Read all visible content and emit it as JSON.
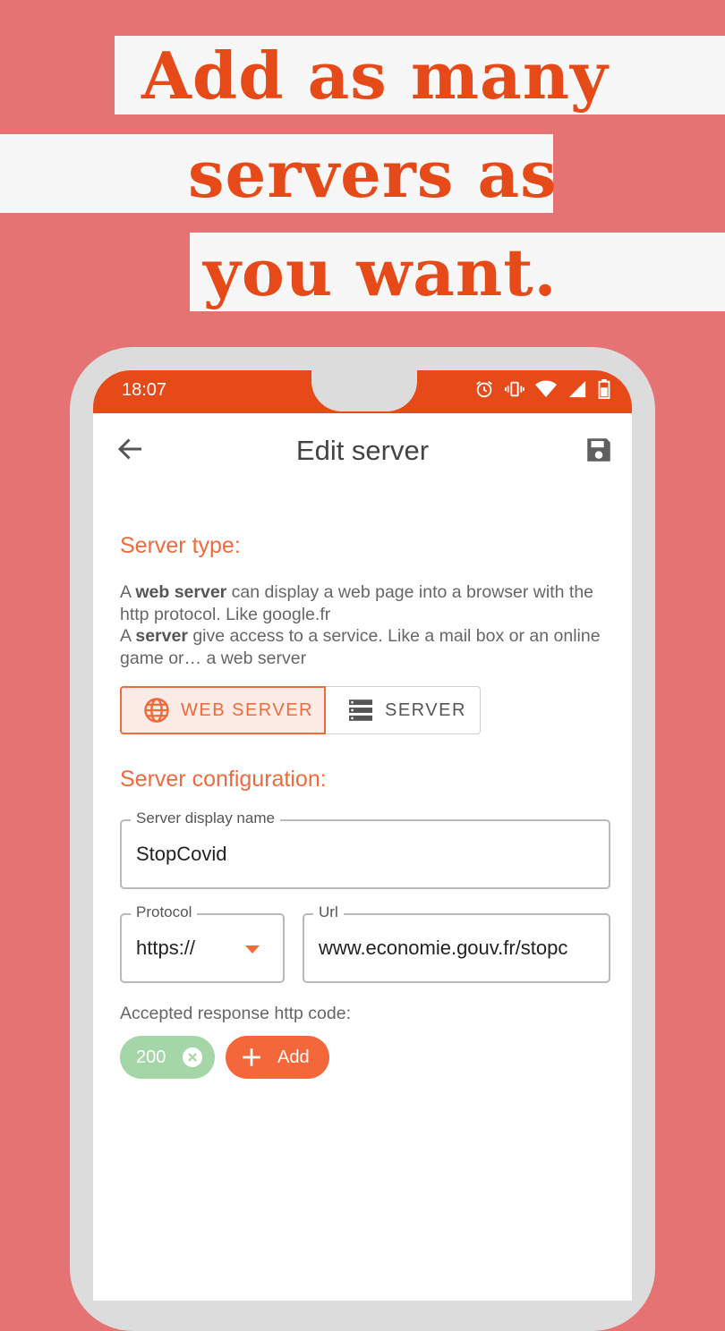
{
  "promo": {
    "line1": "Add as many",
    "line2": "servers as",
    "line3": "you want."
  },
  "statusbar": {
    "time": "18:07"
  },
  "appbar": {
    "title": "Edit server"
  },
  "server_type": {
    "title": "Server type:",
    "desc1_pre": "A ",
    "desc1_bold": "web server",
    "desc1_post": " can display a web page into a browser with the http protocol. Like google.fr",
    "desc2_pre": "A ",
    "desc2_bold": "server",
    "desc2_post": " give access to a service. Like a mail box or an online game or… a web server",
    "web_server_label": "WEB SERVER",
    "server_label": "SERVER",
    "selected": "WEB SERVER"
  },
  "config": {
    "title": "Server configuration:",
    "display_name_label": "Server display name",
    "display_name_value": "StopCovid",
    "protocol_label": "Protocol",
    "protocol_value": "https://",
    "url_label": "Url",
    "url_value": "www.economie.gouv.fr/stopc",
    "codes_label": "Accepted response http code:",
    "codes": [
      "200"
    ],
    "add_label": "Add"
  },
  "colors": {
    "background": "#e57373",
    "accent": "#e64a19",
    "accent_light": "#f06a3c",
    "chip_green": "#a5d6a7"
  }
}
